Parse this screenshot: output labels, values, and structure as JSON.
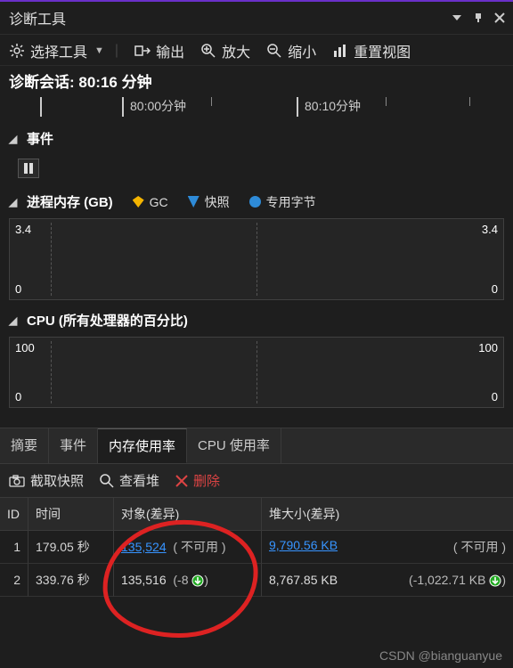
{
  "window": {
    "title": "诊断工具"
  },
  "toolbar": {
    "select_tool": "选择工具",
    "output": "输出",
    "zoom_in": "放大",
    "zoom_out": "缩小",
    "reset_view": "重置视图"
  },
  "session": {
    "label": "诊断会话: 80:16 分钟"
  },
  "ruler": {
    "t1": "80:00分钟",
    "t2": "80:10分钟"
  },
  "sections": {
    "events": "事件",
    "memory": {
      "title": "进程内存 (GB)",
      "legend": {
        "gc": "GC",
        "snap": "快照",
        "priv": "专用字节"
      },
      "yhi": "3.4",
      "ylo": "0"
    },
    "cpu": {
      "title": "CPU (所有处理器的百分比)",
      "yhi": "100",
      "ylo": "0"
    }
  },
  "tabs": {
    "summary": "摘要",
    "events": "事件",
    "memory": "内存使用率",
    "cpu": "CPU 使用率"
  },
  "snapshot_bar": {
    "take": "截取快照",
    "view": "查看堆",
    "delete": "删除"
  },
  "table": {
    "headers": {
      "id": "ID",
      "time": "时间",
      "objects": "对象(差异)",
      "heap": "堆大小(差异)"
    },
    "rows": [
      {
        "id": "1",
        "time": "179.05 秒",
        "objects_count": "135,524",
        "objects_diff": "( 不可用 )",
        "heap_size": "9,790.56 KB",
        "heap_diff": "( 不可用 )"
      },
      {
        "id": "2",
        "time": "339.76 秒",
        "objects_count": "135,516",
        "objects_diff": "(-8 ",
        "heap_size": "8,767.85 KB",
        "heap_diff": "(-1,022.71 KB "
      }
    ],
    "diff_suffix": ")"
  },
  "chart_data": [
    {
      "type": "line",
      "title": "进程内存 (GB)",
      "ylabel": "GB",
      "ylim": [
        0,
        3.4
      ],
      "series": [
        {
          "name": "专用字节",
          "values": []
        }
      ],
      "annotations": [
        "GC",
        "快照"
      ]
    },
    {
      "type": "line",
      "title": "CPU (所有处理器的百分比)",
      "ylabel": "%",
      "ylim": [
        0,
        100
      ],
      "series": [
        {
          "name": "CPU",
          "values": []
        }
      ]
    }
  ],
  "watermark": "CSDN @bianguanyue"
}
